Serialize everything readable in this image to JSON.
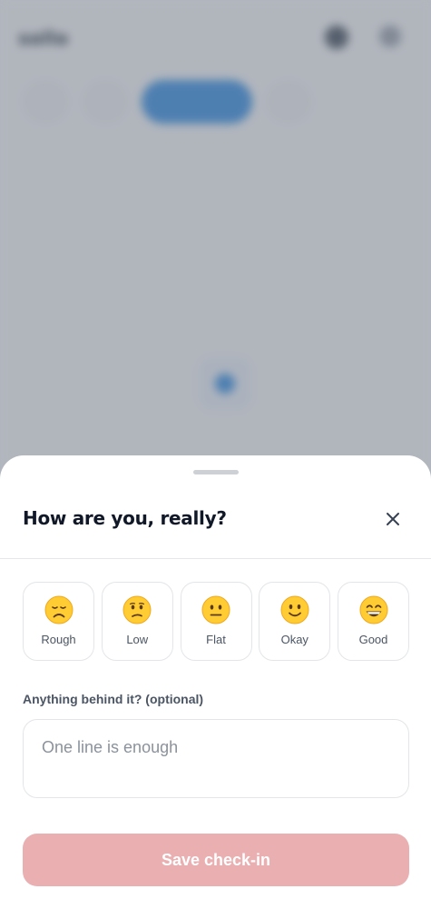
{
  "background_app": {
    "logo": "sollo"
  },
  "sheet": {
    "title": "How are you, really?",
    "close_icon": "close-icon",
    "moods": [
      {
        "label": "Rough",
        "icon": "sad-face-icon"
      },
      {
        "label": "Low",
        "icon": "confused-face-icon"
      },
      {
        "label": "Flat",
        "icon": "neutral-face-icon"
      },
      {
        "label": "Okay",
        "icon": "slight-smile-icon"
      },
      {
        "label": "Good",
        "icon": "grin-face-icon"
      }
    ],
    "note": {
      "label": "Anything behind it? (optional)",
      "placeholder": "One line is enough",
      "value": ""
    },
    "save_label": "Save check-in"
  },
  "colors": {
    "scrim": "#646c7a",
    "save_disabled": "#e9afb1",
    "accent_blue": "#3b8fe0"
  }
}
